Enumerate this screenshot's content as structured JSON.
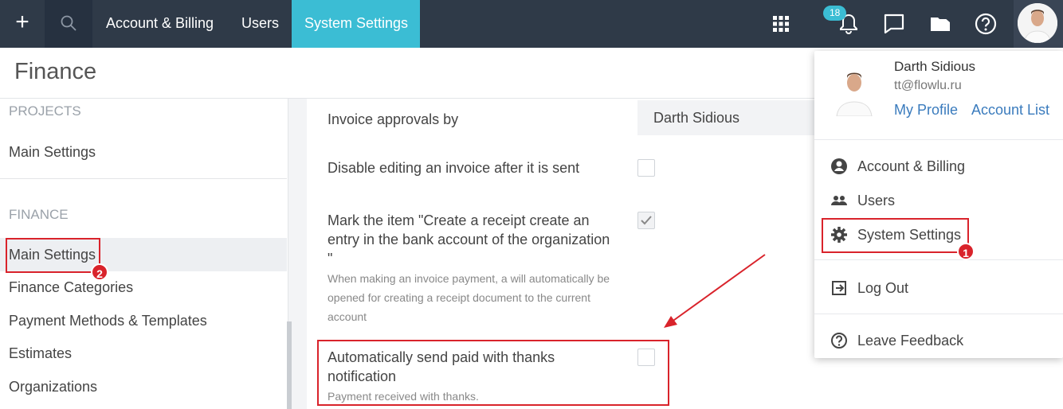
{
  "topbar": {
    "tabs": [
      "Account & Billing",
      "Users",
      "System Settings"
    ],
    "notification_count": "18"
  },
  "page": {
    "title": "Finance"
  },
  "sidebar": {
    "sections": [
      {
        "label": "PROJECTS",
        "items": [
          "Main Settings"
        ]
      },
      {
        "label": "FINANCE",
        "items": [
          "Main Settings",
          "Finance Categories",
          "Payment Methods & Templates",
          "Estimates",
          "Organizations"
        ]
      }
    ]
  },
  "settings": {
    "invoice_approvals": {
      "label": "Invoice approvals by",
      "value": "Darth Sidious"
    },
    "disable_editing": {
      "label": "Disable editing an invoice after it is sent",
      "checked": false
    },
    "mark_item": {
      "label": "Mark the item \"Create a receipt create an entry in the bank account of the organization \"",
      "help": "When making an invoice payment, a will automatically be opened for creating a receipt document to the current account",
      "checked": true
    },
    "auto_send": {
      "label": "Automatically send paid with thanks notification",
      "help": "Payment received with thanks.",
      "checked": false
    }
  },
  "user_menu": {
    "name": "Darth Sidious",
    "email": "tt@flowlu.ru",
    "links": [
      "My Profile",
      "Account List"
    ],
    "items": [
      "Account & Billing",
      "Users",
      "System Settings",
      "Log Out",
      "Leave Feedback"
    ]
  },
  "annotations": {
    "marker1": "1",
    "marker2": "2"
  },
  "colors": {
    "topbar": "#2f3a48",
    "accent": "#3bbdd4",
    "highlight": "#d9232b",
    "link": "#3a7bbd"
  }
}
